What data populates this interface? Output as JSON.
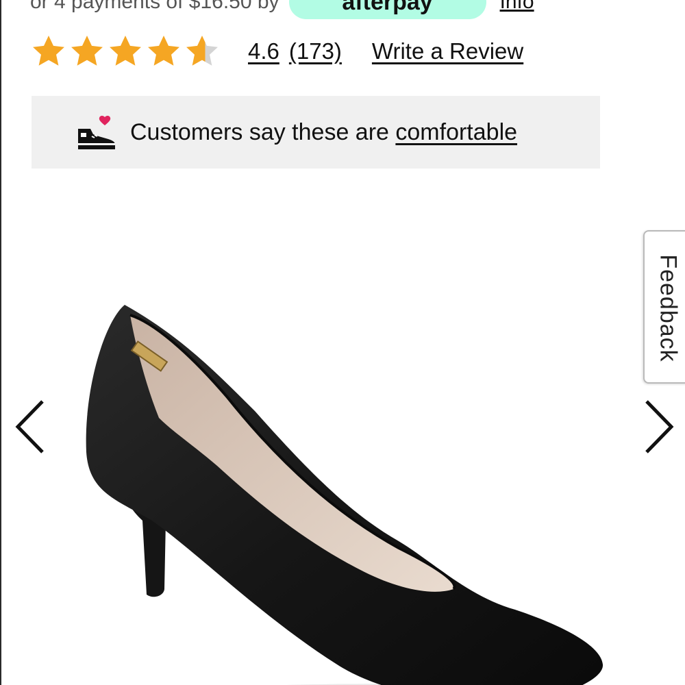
{
  "payment": {
    "text": "or 4 payments of $16.50 by",
    "provider": "afterpay",
    "info_label": "Info",
    "pill_color": "#b2fce4"
  },
  "rating": {
    "value": "4.6",
    "count": "(173)",
    "stars_filled": 4.6,
    "stars_total": 5,
    "star_color": "#f5a623",
    "write_review_label": "Write a Review"
  },
  "comfort": {
    "icon": "sneaker-heart-icon",
    "text": "Customers say these are ",
    "link": "comfortable"
  },
  "gallery": {
    "prev_icon": "chevron-left-icon",
    "next_icon": "chevron-right-icon",
    "image": "black-pointed-toe-pump"
  },
  "feedback": {
    "label": "Feedback"
  }
}
